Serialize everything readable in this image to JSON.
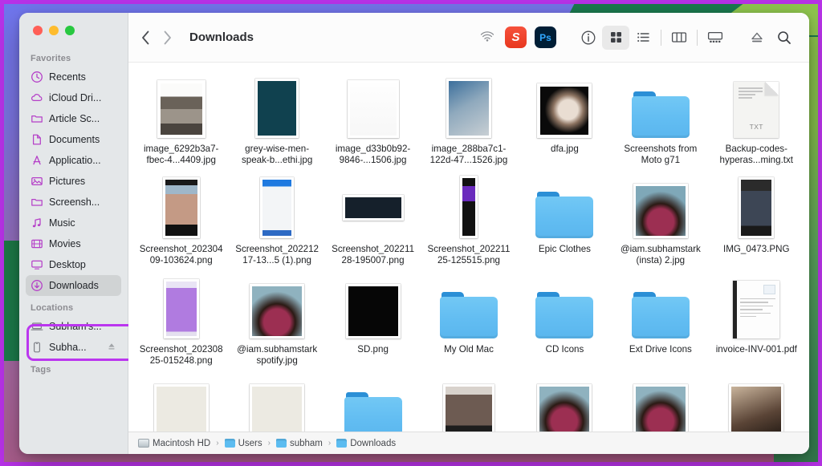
{
  "window": {
    "title": "Downloads",
    "traffic_lights": [
      "close",
      "minimize",
      "zoom"
    ]
  },
  "toolbar": {
    "back_label": "Back",
    "forward_label": "Forward",
    "airdrop_label": "AirDrop",
    "apps": [
      {
        "name": "Setapp",
        "glyph": "S"
      },
      {
        "name": "Adobe Photoshop",
        "glyph": "Ps"
      }
    ],
    "info_label": "Info",
    "views": [
      {
        "name": "icon-view",
        "label": "Icon View",
        "active": true
      },
      {
        "name": "list-view",
        "label": "List View",
        "active": false
      },
      {
        "name": "column-view",
        "label": "Column View",
        "active": false
      },
      {
        "name": "gallery-view",
        "label": "Gallery View",
        "active": false
      }
    ],
    "eject_label": "Eject",
    "search_label": "Search"
  },
  "sidebar": {
    "sections": [
      {
        "header": "Favorites",
        "items": [
          {
            "label": "Recents",
            "icon": "clock-icon",
            "selected": false
          },
          {
            "label": "iCloud Dri...",
            "icon": "cloud-icon",
            "selected": false
          },
          {
            "label": "Article Sc...",
            "icon": "folder-icon",
            "selected": false
          },
          {
            "label": "Documents",
            "icon": "document-icon",
            "selected": false
          },
          {
            "label": "Applicatio...",
            "icon": "appstore-icon",
            "selected": false
          },
          {
            "label": "Pictures",
            "icon": "picture-icon",
            "selected": false
          },
          {
            "label": "Screensh...",
            "icon": "folder-icon",
            "selected": false
          },
          {
            "label": "Music",
            "icon": "music-note-icon",
            "selected": false
          },
          {
            "label": "Movies",
            "icon": "film-icon",
            "selected": false
          },
          {
            "label": "Desktop",
            "icon": "desktop-icon",
            "selected": false
          },
          {
            "label": "Downloads",
            "icon": "download-arrow-icon",
            "selected": true
          }
        ]
      },
      {
        "header": "Locations",
        "items": [
          {
            "label": "Subham's...",
            "icon": "laptop-icon",
            "selected": false
          },
          {
            "label": "Subha...",
            "icon": "iphone-icon",
            "selected": false,
            "eject": true
          }
        ]
      },
      {
        "header": "Tags",
        "items": []
      }
    ]
  },
  "annotation": {
    "target": "Downloads",
    "color": "#bb36ef",
    "shape": "rounded-rectangle"
  },
  "files": [
    {
      "name": "image_6292b3a7-fbec-4...4409.jpg",
      "type": "photo",
      "thumb": "office-desk-photo"
    },
    {
      "name": "grey-wise-men-speak-b...ethi.jpg",
      "type": "photo",
      "thumb": "dark-teal-quote-poster"
    },
    {
      "name": "image_d33b0b92-9846-...1506.jpg",
      "type": "photo",
      "thumb": "white-tweet-screenshot"
    },
    {
      "name": "image_288ba7c1-122d-47...1526.jpg",
      "type": "photo",
      "thumb": "blue-building-photo"
    },
    {
      "name": "dfa.jpg",
      "type": "photo",
      "thumb": "cat-thumbs-up-photo"
    },
    {
      "name": "Screenshots from Moto g71",
      "type": "folder",
      "thumb": "blue-folder"
    },
    {
      "name": "Backup-codes-hyperas...ming.txt",
      "type": "text",
      "thumb": "txt-document",
      "kind": "TXT"
    },
    {
      "name": "Screenshot_20230409-103624.png",
      "type": "photo",
      "thumb": "phone-screenshot-hand"
    },
    {
      "name": "Screenshot_20221217-13...5 (1).png",
      "type": "photo",
      "thumb": "phone-screenshot-blue-app"
    },
    {
      "name": "Screenshot_20221128-195007.png",
      "type": "photo",
      "thumb": "dark-tweet-screenshot"
    },
    {
      "name": "Screenshot_20221125-125515.png",
      "type": "photo",
      "thumb": "tall-dark-purple-screenshot"
    },
    {
      "name": "Epic Clothes",
      "type": "folder",
      "thumb": "blue-folder"
    },
    {
      "name": "@iam.subhamstark (insta) 2.jpg",
      "type": "photo",
      "thumb": "man-glasses-portrait"
    },
    {
      "name": "IMG_0473.PNG",
      "type": "photo",
      "thumb": "iphone-homescreen"
    },
    {
      "name": "Screenshot_20230825-015248.png",
      "type": "photo",
      "thumb": "purple-app-screenshot"
    },
    {
      "name": "@iam.subhamstark spotify.jpg",
      "type": "photo",
      "thumb": "man-glasses-portrait"
    },
    {
      "name": "SD.png",
      "type": "photo",
      "thumb": "sag-dragon-films-black-logo"
    },
    {
      "name": "My Old Mac",
      "type": "folder",
      "thumb": "blue-folder"
    },
    {
      "name": "CD Icons",
      "type": "folder",
      "thumb": "blue-folder"
    },
    {
      "name": "Ext Drive Icons",
      "type": "folder",
      "thumb": "blue-folder"
    },
    {
      "name": "invoice-INV-001.pdf",
      "type": "pdf",
      "thumb": "invoice-document"
    },
    {
      "name": "",
      "type": "photo",
      "thumb": "s-dot-logo"
    },
    {
      "name": "",
      "type": "photo",
      "thumb": "subham-wordmark"
    },
    {
      "name": "",
      "type": "folder",
      "thumb": "blue-folder"
    },
    {
      "name": "",
      "type": "photo",
      "thumb": "meme-screenshot"
    },
    {
      "name": "",
      "type": "photo",
      "thumb": "man-glasses-portrait"
    },
    {
      "name": "",
      "type": "photo",
      "thumb": "man-glasses-portrait"
    },
    {
      "name": "",
      "type": "photo",
      "thumb": "man-portrait"
    }
  ],
  "pathbar": {
    "crumbs": [
      {
        "label": "Macintosh HD",
        "icon": "harddisk-icon"
      },
      {
        "label": "Users",
        "icon": "folder-icon"
      },
      {
        "label": "subham",
        "icon": "home-folder-icon"
      },
      {
        "label": "Downloads",
        "icon": "folder-icon"
      }
    ],
    "separator": "›"
  },
  "colors": {
    "sidebar_icon": "#b540c8",
    "folder_blue": "#5cbcf0",
    "annotation_purple": "#bb36ef",
    "setapp_red": "#ee3b22",
    "photoshop_navy": "#001e36"
  }
}
